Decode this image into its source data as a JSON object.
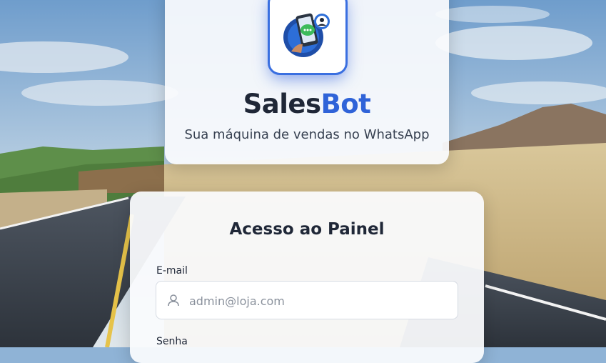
{
  "brand": {
    "name_part1": "Sales",
    "name_part2": "Bot",
    "tagline": "Sua máquina de vendas no WhatsApp",
    "logo_icon": "phone-chat-icon",
    "accent_color": "#2f63d8"
  },
  "login": {
    "title": "Acesso ao Painel",
    "email_label": "E-mail",
    "email_placeholder": "admin@loja.com",
    "email_icon": "user-icon",
    "password_label": "Senha"
  }
}
